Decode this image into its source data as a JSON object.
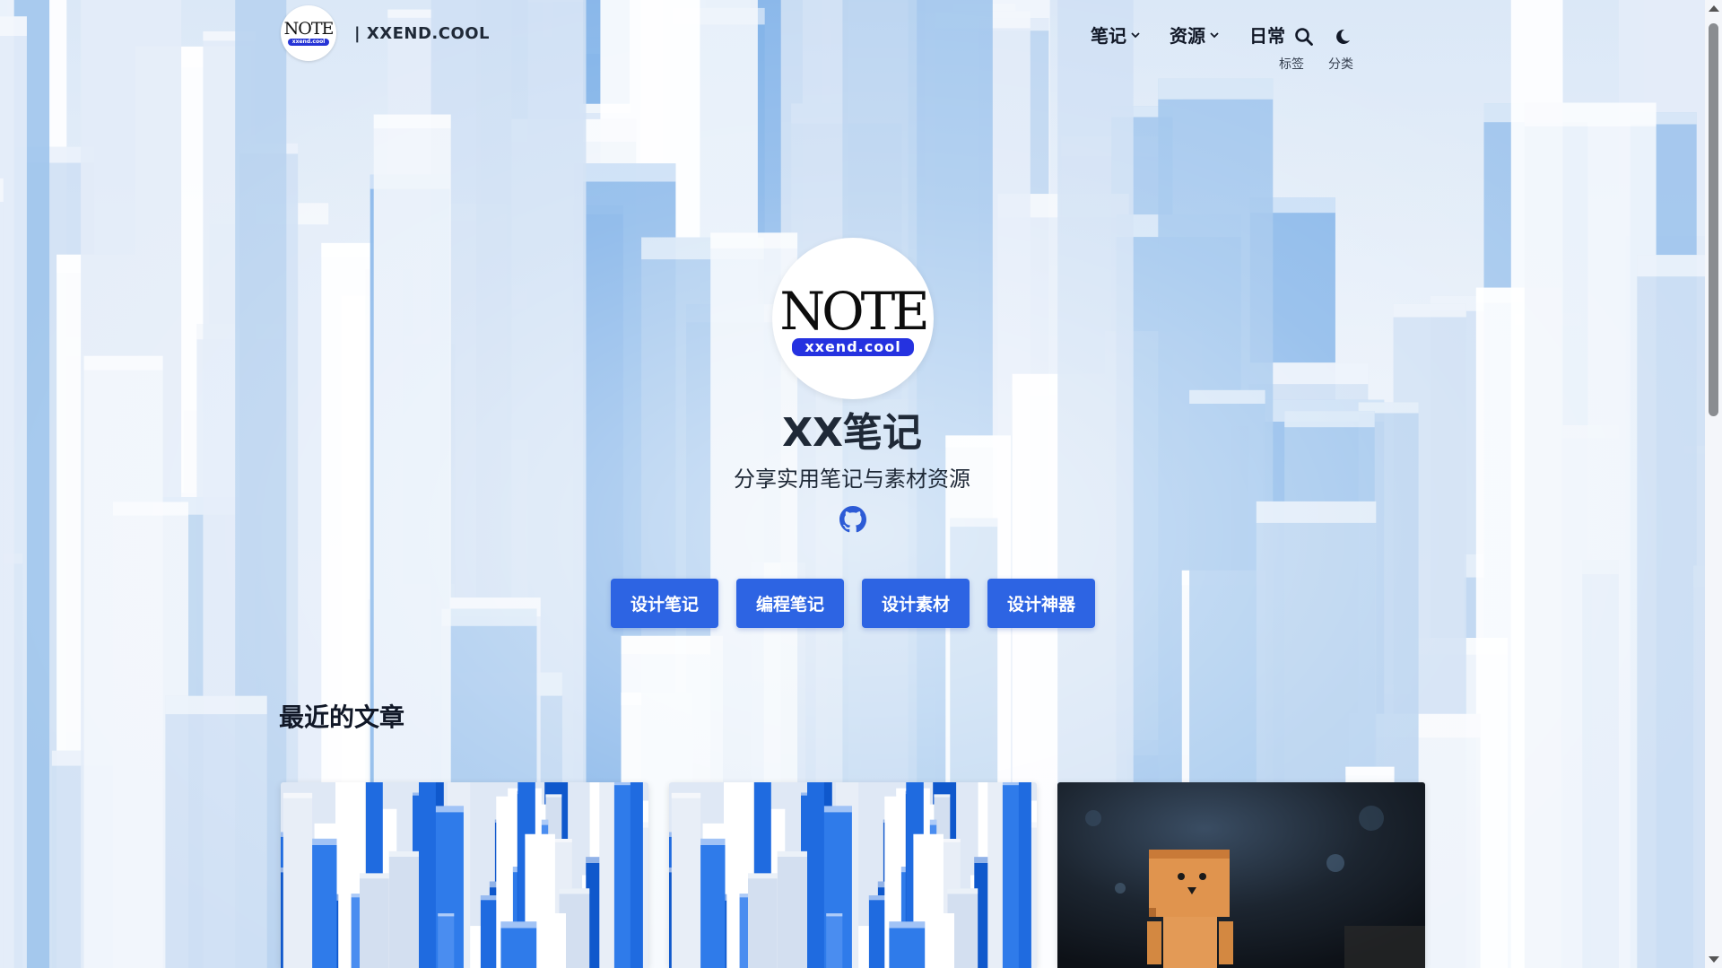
{
  "colors": {
    "primary_button": "#2d64e3",
    "logo_badge": "#2532e0",
    "text_dark": "#1f2937"
  },
  "header": {
    "logo_text": "NOTE",
    "logo_badge": "xxend.cool",
    "site_name": "| XXEND.COOL",
    "nav": {
      "notes": "笔记",
      "resources": "资源",
      "daily": "日常",
      "tags": "标签",
      "categories": "分类"
    },
    "icons": [
      "chevron-down-icon",
      "search-icon",
      "moon-icon"
    ]
  },
  "hero": {
    "logo_text": "NOTE",
    "logo_badge": "xxend.cool",
    "title": "XX笔记",
    "subtitle": "分享实用笔记与素材资源",
    "social_icon": "github-icon",
    "buttons": [
      "设计笔记",
      "编程笔记",
      "设计素材",
      "设计神器"
    ]
  },
  "recent": {
    "title": "最近的文章",
    "cards": [
      {
        "image": "blue-blocks"
      },
      {
        "image": "blue-blocks"
      },
      {
        "image": "cardboard-robot"
      }
    ]
  }
}
